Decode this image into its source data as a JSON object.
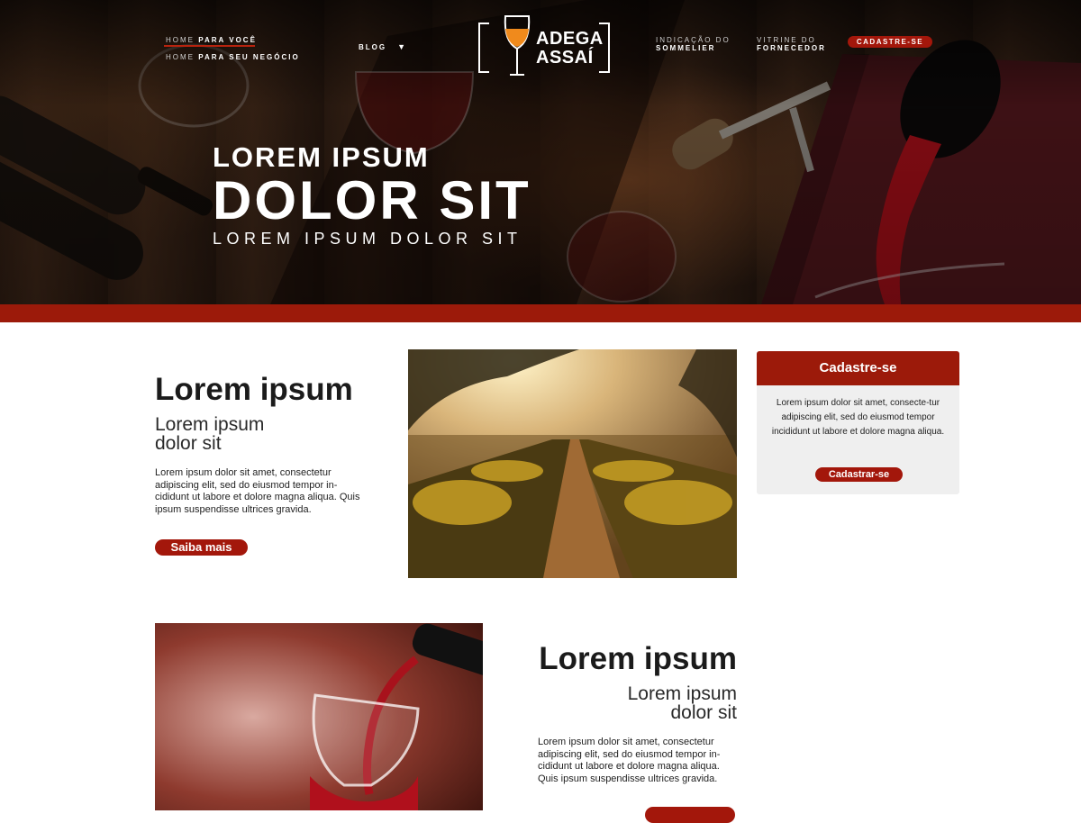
{
  "nav": {
    "home_pessoal": {
      "prefix": "HOME",
      "label": "PARA VOCÊ"
    },
    "home_negocio": {
      "prefix": "HOME",
      "label": "PARA SEU NEGÓCIO"
    },
    "blog": "BLOG",
    "sommelier": {
      "line1": "INDICAÇÃO DO",
      "line2": "SOMMELIER"
    },
    "fornecedor": {
      "line1": "VITRINE DO",
      "line2": "FORNECEDOR"
    },
    "cadastre": "CADASTRE-SE"
  },
  "logo": {
    "line1": "ADEGA",
    "line2": "ASSAÍ"
  },
  "hero": {
    "line1": "LOREM IPSUM",
    "line2": "DOLOR SIT",
    "line3": "LOREM IPSUM DOLOR SIT"
  },
  "section1": {
    "title": "Lorem ipsum",
    "subtitle_line1": "Lorem ipsum",
    "subtitle_line2": "dolor sit",
    "body": "Lorem ipsum dolor sit amet, consectetur adipiscing elit, sed do eiusmod tempor in-cididunt ut labore et dolore magna aliqua. Quis ipsum suspendisse ultrices gravida.",
    "button": "Saiba mais"
  },
  "card": {
    "title": "Cadastre-se",
    "text": "Lorem ipsum dolor sit amet, consecte-tur adipiscing elit, sed do eiusmod tempor incididunt ut labore et dolore magna aliqua.",
    "button": "Cadastrar-se"
  },
  "section2": {
    "title": "Lorem ipsum",
    "subtitle_line1": "Lorem ipsum",
    "subtitle_line2": "dolor sit",
    "body": "Lorem ipsum dolor sit amet, consectetur adipiscing elit, sed do eiusmod tempor in-cididunt ut labore et dolore magna aliqua. Quis ipsum suspendisse ultrices gravida."
  },
  "colors": {
    "accent": "#9c1a0a",
    "button": "#a3170b",
    "card_bg": "#efefef"
  }
}
